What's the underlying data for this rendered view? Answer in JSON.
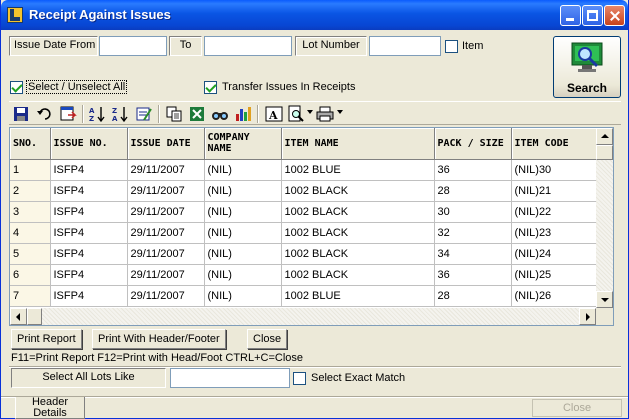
{
  "window": {
    "title": "Receipt Against Issues"
  },
  "filters": {
    "issue_date_from_label": "Issue Date From",
    "issue_date_from_value": "",
    "to_label": "To",
    "to_value": "",
    "lot_number_label": "Lot Number",
    "lot_number_value": "",
    "item_label": "Item",
    "item_checked": false,
    "select_all_label": "Select / Unselect All",
    "select_all_checked": true,
    "transfer_label": "Transfer Issues In Receipts",
    "transfer_checked": true
  },
  "search": {
    "label": "Search"
  },
  "toolbar": {
    "icons": [
      "save-icon",
      "undo-icon",
      "export-icon",
      "sort-ascending-icon",
      "sort-descending-icon",
      "filter-icon",
      "copy-icon",
      "excel-icon",
      "find-icon",
      "chart-icon",
      "font-icon",
      "print-preview-icon",
      "print-icon"
    ]
  },
  "grid": {
    "columns": [
      "SNO.",
      "ISSUE NO.",
      "ISSUE DATE",
      "COMPANY NAME",
      "ITEM NAME",
      "PACK / SIZE",
      "ITEM CODE"
    ],
    "rows": [
      [
        "1",
        "ISFP4",
        "29/11/2007",
        "(NIL)",
        "1002 BLUE",
        "36",
        "(NIL)30"
      ],
      [
        "2",
        "ISFP4",
        "29/11/2007",
        "(NIL)",
        "1002 BLACK",
        "28",
        "(NIL)21"
      ],
      [
        "3",
        "ISFP4",
        "29/11/2007",
        "(NIL)",
        "1002 BLACK",
        "30",
        "(NIL)22"
      ],
      [
        "4",
        "ISFP4",
        "29/11/2007",
        "(NIL)",
        "1002 BLACK",
        "32",
        "(NIL)23"
      ],
      [
        "5",
        "ISFP4",
        "29/11/2007",
        "(NIL)",
        "1002 BLACK",
        "34",
        "(NIL)24"
      ],
      [
        "6",
        "ISFP4",
        "29/11/2007",
        "(NIL)",
        "1002 BLACK",
        "36",
        "(NIL)25"
      ],
      [
        "7",
        "ISFP4",
        "29/11/2007",
        "(NIL)",
        "1002 BLUE",
        "28",
        "(NIL)26"
      ]
    ]
  },
  "actions": {
    "print_report": "Print Report",
    "print_with_header": "Print With Header/Footer",
    "close": "Close"
  },
  "hint": "F11=Print Report  F12=Print with Head/Foot  CTRL+C=Close",
  "lots": {
    "label": "Select All Lots Like",
    "value": "",
    "exact_match_label": "Select Exact Match",
    "exact_match_checked": false
  },
  "bottom": {
    "header_details": "Header Details",
    "close": "Close"
  }
}
